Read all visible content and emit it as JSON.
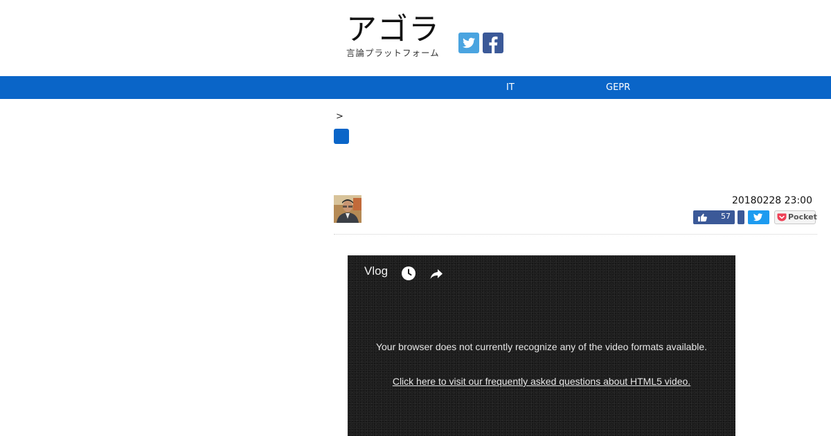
{
  "header": {
    "logo_main": "アゴラ",
    "logo_sub": "言論プラットフォーム"
  },
  "nav": {
    "items": [
      "IT",
      "GEPR"
    ]
  },
  "breadcrumb": {
    "separator": ">"
  },
  "post": {
    "date": "20180228 23:00",
    "like_count": "57"
  },
  "share": {
    "pocket_label": "Pocket"
  },
  "video": {
    "title": "Vlog",
    "message": "Your browser does not currently recognize any of the video formats available.",
    "link_text": "Click here to visit our frequently asked questions about HTML5 video."
  },
  "colors": {
    "nav_bar": "#0a65c8",
    "twitter": "#4aa4e0",
    "facebook": "#3b5998",
    "video_bg": "#1b1b1b"
  }
}
